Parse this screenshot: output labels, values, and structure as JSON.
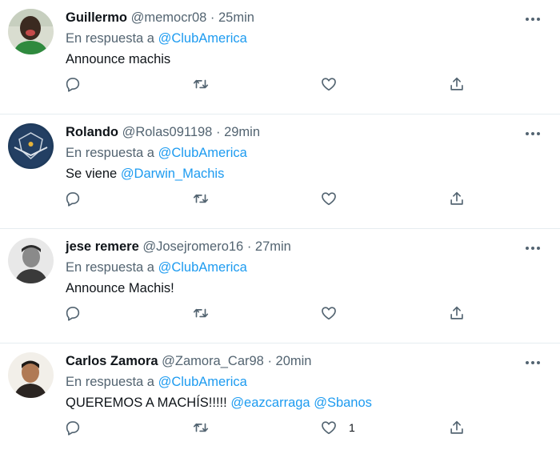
{
  "tweets": [
    {
      "name": "Guillermo",
      "handle": "@memocr08",
      "time": "25min",
      "reply_prefix": "En respuesta a",
      "reply_to": "@ClubAmerica",
      "text": "Announce machis",
      "mentions": "",
      "like_count": "",
      "avatar": "green-shirt-person"
    },
    {
      "name": "Rolando",
      "handle": "@Rolas091198",
      "time": "29min",
      "reply_prefix": "En respuesta a",
      "reply_to": "@ClubAmerica",
      "text": "Se viene",
      "mentions": "@Darwin_Machis",
      "like_count": "",
      "avatar": "blue-crest-logo"
    },
    {
      "name": "jese remere",
      "handle": "@Josejromero16",
      "time": "27min",
      "reply_prefix": "En respuesta a",
      "reply_to": "@ClubAmerica",
      "text": "Announce Machis!",
      "mentions": "",
      "like_count": "",
      "avatar": "grayscale-person"
    },
    {
      "name": "Carlos Zamora",
      "handle": "@Zamora_Car98",
      "time": "20min",
      "reply_prefix": "En respuesta a",
      "reply_to": "@ClubAmerica",
      "text": "QUEREMOS A MACHÍS!!!!!",
      "mentions": "@eazcarraga @Sbanos",
      "like_count": "1",
      "avatar": "person-photo"
    }
  ],
  "icons": {
    "reply": "reply-icon",
    "retweet": "retweet-icon",
    "like": "heart-icon",
    "share": "share-icon",
    "more": "more-options-icon"
  },
  "colors": {
    "link": "#1d9bf0",
    "secondary_text": "#536471",
    "primary_text": "#0f1419",
    "divider": "#e6ecf0"
  }
}
